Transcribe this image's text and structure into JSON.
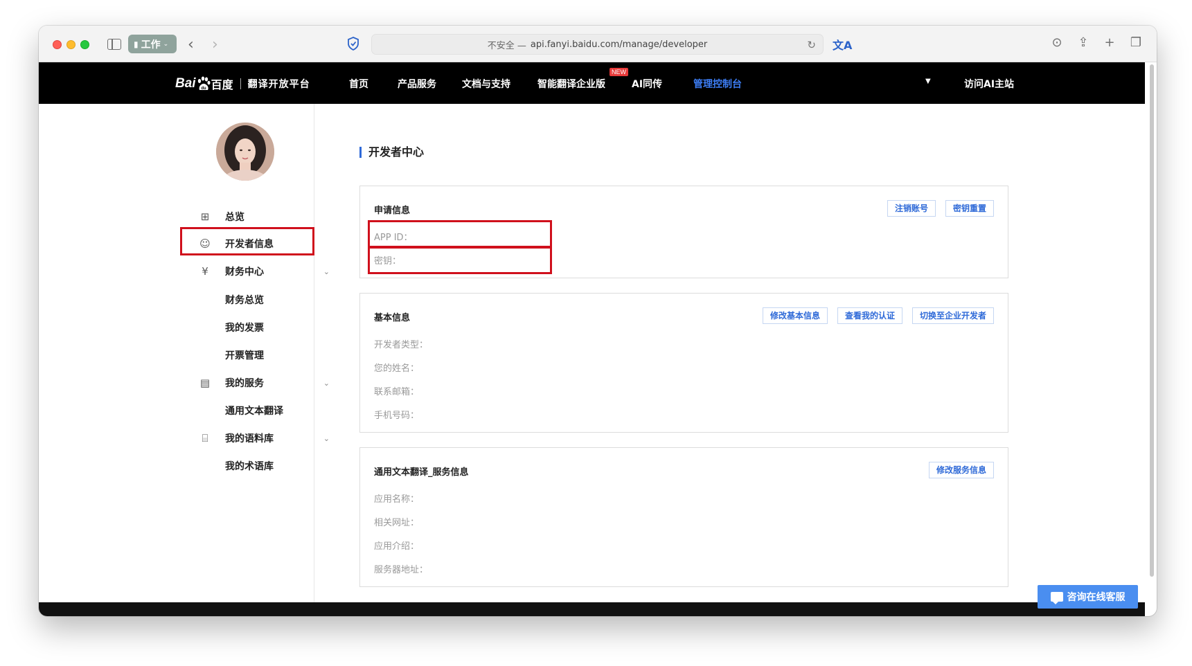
{
  "browser": {
    "tab_group_label": "工作",
    "url_prefix": "不安全 —",
    "url": "api.fanyi.baidu.com/manage/developer"
  },
  "header": {
    "logo_bai": "Bai",
    "logo_baidu_cn": "百度",
    "platform": "翻译开放平台",
    "nav": [
      {
        "label": "首页"
      },
      {
        "label": "产品服务"
      },
      {
        "label": "文档与支持"
      },
      {
        "label": "智能翻译企业版"
      },
      {
        "label": "AI同传"
      },
      {
        "label": "管理控制台"
      }
    ],
    "new_badge": "NEW",
    "visit_ai": "访问AI主站",
    "colors": {
      "active": "#3c7df4",
      "badge": "#e83a3a"
    }
  },
  "sidebar": {
    "items": [
      {
        "label": "总览",
        "icon": "grid-icon"
      },
      {
        "label": "开发者信息",
        "icon": "user-icon"
      },
      {
        "label": "财务中心",
        "icon": "yen-icon"
      },
      {
        "label": "财务总览"
      },
      {
        "label": "我的发票"
      },
      {
        "label": "开票管理"
      },
      {
        "label": "我的服务",
        "icon": "document-icon"
      },
      {
        "label": "通用文本翻译"
      },
      {
        "label": "我的语料库",
        "icon": "archive-icon"
      },
      {
        "label": "我的术语库"
      }
    ]
  },
  "main": {
    "title": "开发者中心",
    "apply_info": {
      "title": "申请信息",
      "fields": [
        "APP ID：",
        "密钥："
      ],
      "buttons": [
        "注销账号",
        "密钥重置"
      ]
    },
    "basic_info": {
      "title": "基本信息",
      "fields": [
        "开发者类型：",
        "您的姓名：",
        "联系邮箱：",
        "手机号码："
      ],
      "buttons": [
        "修改基本信息",
        "查看我的认证",
        "切换至企业开发者"
      ]
    },
    "service_info": {
      "title": "通用文本翻译_服务信息",
      "fields": [
        "应用名称：",
        "相关网址：",
        "应用介绍：",
        "服务器地址："
      ],
      "buttons": [
        "修改服务信息"
      ]
    }
  },
  "chat": {
    "label": "咨询在线客服"
  },
  "highlight_color": "#d0101c",
  "accent_color": "#2f6ad8"
}
